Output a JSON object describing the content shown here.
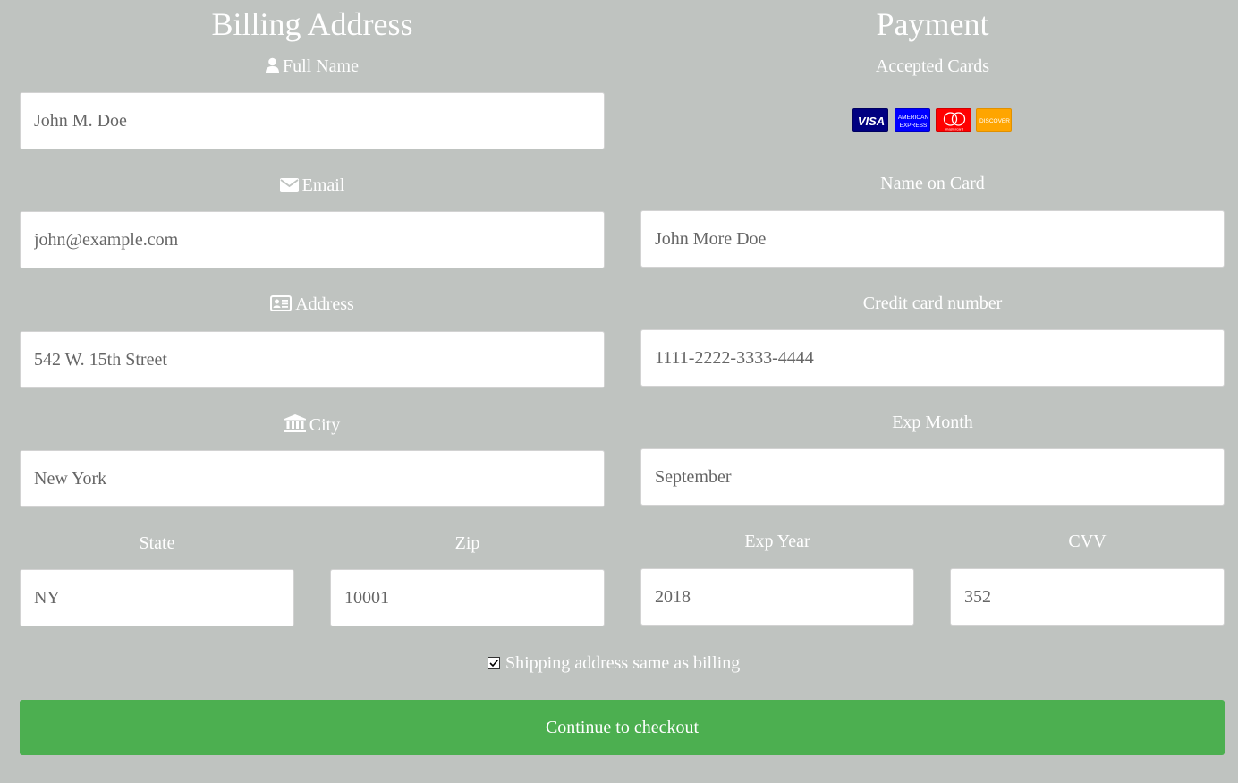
{
  "billing": {
    "title": "Billing Address",
    "full_name": {
      "label": "Full Name",
      "icon": "user-icon",
      "value": "John M. Doe"
    },
    "email": {
      "label": "Email",
      "icon": "envelope-icon",
      "value": "john@example.com"
    },
    "address": {
      "label": "Address",
      "icon": "address-card-icon",
      "value": "542 W. 15th Street"
    },
    "city": {
      "label": "City",
      "icon": "institution-icon",
      "value": "New York"
    },
    "state": {
      "label": "State",
      "value": "NY"
    },
    "zip": {
      "label": "Zip",
      "value": "10001"
    }
  },
  "payment": {
    "title": "Payment",
    "accepted_cards_label": "Accepted Cards",
    "cards": [
      {
        "name": "visa",
        "icon": "visa-card-icon",
        "text": "VISA",
        "color": "#000080"
      },
      {
        "name": "amex",
        "icon": "amex-card-icon",
        "text": "AMERICAN EXPRESS",
        "color": "#0000ff"
      },
      {
        "name": "mastercard",
        "icon": "mastercard-card-icon",
        "text": "mastercard",
        "color": "#ff0000"
      },
      {
        "name": "discover",
        "icon": "discover-card-icon",
        "text": "DISCOVER",
        "color": "#ffa500"
      }
    ],
    "name_on_card": {
      "label": "Name on Card",
      "value": "John More Doe"
    },
    "card_number": {
      "label": "Credit card number",
      "value": "1111-2222-3333-4444"
    },
    "exp_month": {
      "label": "Exp Month",
      "value": "September"
    },
    "exp_year": {
      "label": "Exp Year",
      "value": "2018"
    },
    "cvv": {
      "label": "CVV",
      "value": "352"
    }
  },
  "shipping_same": {
    "label": "Shipping address same as billing",
    "checked": true
  },
  "checkout_button": {
    "label": "Continue to checkout",
    "color": "#4caf50"
  },
  "colors": {
    "background": "#bfc3c0",
    "text": "#ffffff"
  }
}
